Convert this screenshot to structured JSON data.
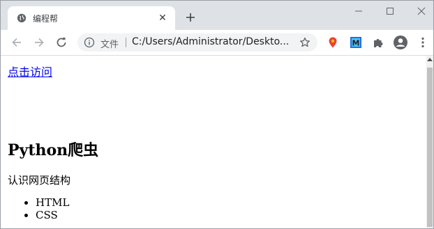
{
  "browser": {
    "tab": {
      "title": "编程帮",
      "close_glyph": "✕",
      "favicon": "globe-icon"
    },
    "new_tab_icon": "plus-icon",
    "window_controls": [
      "minimize-icon",
      "maximize-icon",
      "close-icon"
    ],
    "toolbar": {
      "back_icon": "arrow-left-icon",
      "forward_icon": "arrow-right-icon",
      "reload_icon": "reload-icon",
      "omnibox": {
        "info_icon": "info-icon",
        "scheme_label": "文件",
        "url": "C:/Users/Administrator/Deskto...",
        "bookmark_icon": "star-icon"
      },
      "extensions": [
        {
          "name": "map-pin-extension-icon",
          "color": "#e94235"
        },
        {
          "name": "m-extension-icon",
          "color": "#1a73e8",
          "label": "M"
        },
        {
          "name": "puzzle-extensions-icon",
          "color": "#5f6368"
        }
      ],
      "profile_icon": "account-circle-icon",
      "menu_icon": "kebab-menu-icon"
    }
  },
  "page": {
    "link_text": "点击访问",
    "heading": "Python爬虫",
    "paragraph": "认识网页结构",
    "list": [
      "HTML",
      "CSS"
    ]
  },
  "colors": {
    "tabstrip_bg": "#dee1e6",
    "link": "#0000ee",
    "omnibox_bg": "#f1f3f4"
  }
}
